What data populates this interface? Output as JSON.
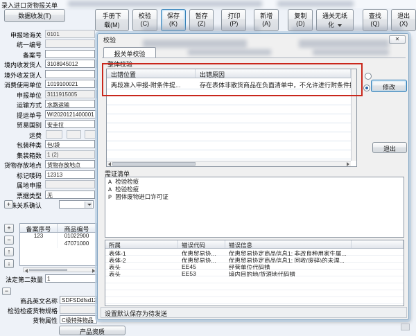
{
  "window": {
    "title": "录入进口货物报关单"
  },
  "toolbar": {
    "data_send": "数据收发(T)",
    "buttons": [
      "手册下载(M)",
      "校验(C)",
      "保存(K)",
      "暂存(Z)",
      "打印(P)",
      "新增(A)",
      "复制(D)",
      "通关无纸化",
      "查找(Q)",
      "退出(X)"
    ]
  },
  "icons": {
    "close": "✕",
    "plus": "+",
    "minus": "−",
    "up": "↑",
    "down": "↓"
  },
  "form": {
    "fields": [
      {
        "label": "申报地海关",
        "value": "0101"
      },
      {
        "label": "统一编号",
        "value": ""
      },
      {
        "label": "备案号",
        "value": ""
      },
      {
        "label": "境内收发货人",
        "value": "3108945012",
        "extra": "1"
      },
      {
        "label": "境外收发货人",
        "value": ""
      },
      {
        "label": "消费使用单位",
        "value": "1019100021",
        "extra": "1"
      },
      {
        "label": "申报单位",
        "value": "3111915005",
        "extra": "1"
      },
      {
        "label": "运输方式",
        "value": "水路运输"
      },
      {
        "label": "提运单号",
        "value": "WI2020121400001"
      },
      {
        "label": "贸易国别",
        "value": "安圭拉"
      },
      {
        "label": "运费",
        "value": ""
      },
      {
        "label": "包装种类",
        "value": "包/袋"
      },
      {
        "label": "集装箱数",
        "value": "1 (2)"
      },
      {
        "label": "货物存放地点",
        "value": "货物存放地点"
      },
      {
        "label": "标记唛码",
        "value": "12313"
      },
      {
        "label": "属地申报",
        "value": ""
      },
      {
        "label": "票据类型",
        "value": "无"
      },
      {
        "label": "特殊关系确认",
        "value": ""
      }
    ]
  },
  "item_table": {
    "columns": [
      "备案序号",
      "商品编号"
    ],
    "rows": [
      [
        "123",
        "01022900"
      ],
      [
        "",
        "47071000"
      ]
    ]
  },
  "item_fields": {
    "qty2_label": "法定第二数量",
    "qty2_value": "1",
    "en_name_label": "商品英文名称",
    "en_name_value": "SDFSDdfsd12",
    "ciq_spec_label": "检验检疫货物规格",
    "ciq_spec_value": "",
    "attr_label": "货物属性",
    "attr_value": "C级特殊物品",
    "bottom_button": "产品资质"
  },
  "dialog": {
    "title": "校验",
    "tab": "报关单校验",
    "section": "整体校验",
    "error_grid": {
      "columns": [
        "出错位置",
        "出错原因"
      ],
      "rows": [
        {
          "position": "两段准入申报-附条件提...",
          "reason": "存在表体非散货商品在负面清单中，不允许进行附条件提离申请！"
        }
      ]
    },
    "modify_button": "修改",
    "exit_button": "退出",
    "cert_list": {
      "title": "需证清单",
      "items": [
        "A 检验检疫",
        "A 检验检疫",
        "P 固体废物进口许可证"
      ]
    },
    "detail_grid": {
      "columns": [
        "所属",
        "错误代码",
        "错误信息"
      ],
      "rows": [
        {
          "scope": "表体-1",
          "code": "优惠贸易协...",
          "message": "优惠贸易协定商品信息1: 非改良种用家牛属..."
        },
        {
          "scope": "表体-2",
          "code": "优惠贸易协...",
          "message": "优惠贸易协定商品信息1: 回收(废碎)的未漂..."
        },
        {
          "scope": "表头",
          "code": "EE45",
          "message": "经营单位代码错"
        },
        {
          "scope": "表头",
          "code": "EE53",
          "message": "境内目的地/货源地代码错"
        }
      ]
    },
    "status": "设置默认保存为待发送"
  },
  "colors": {
    "highlight_red": "#c9271c",
    "focus_blue": "#2f7cb5",
    "window_bg": "#eef2f8"
  }
}
